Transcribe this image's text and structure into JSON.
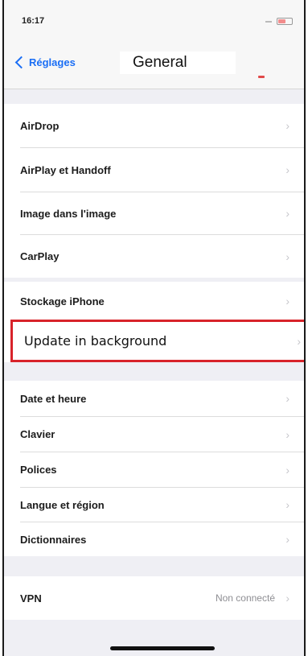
{
  "status_bar": {
    "time": "16:17"
  },
  "nav": {
    "back_label": "Réglages",
    "title": "General"
  },
  "groups": [
    {
      "items": [
        {
          "label": "AirDrop"
        },
        {
          "label": "AirPlay et Handoff"
        },
        {
          "label": "Image dans l'image"
        },
        {
          "label": "CarPlay"
        }
      ]
    },
    {
      "items": [
        {
          "label": "Stockage iPhone"
        },
        {
          "label": "Update in background",
          "highlighted": true
        }
      ]
    },
    {
      "items": [
        {
          "label": "Date et heure"
        },
        {
          "label": "Clavier"
        },
        {
          "label": "Polices"
        },
        {
          "label": "Langue et région"
        },
        {
          "label": "Dictionnaires"
        }
      ]
    },
    {
      "items": [
        {
          "label": "VPN",
          "value": "Non connecté"
        }
      ]
    }
  ],
  "chevron": "›",
  "colors": {
    "accent": "#1a6ef5",
    "highlight_border": "#d8232a"
  },
  "icons": {
    "back": "chevron-left-icon",
    "disclosure": "chevron-right-icon",
    "battery": "battery-icon"
  }
}
